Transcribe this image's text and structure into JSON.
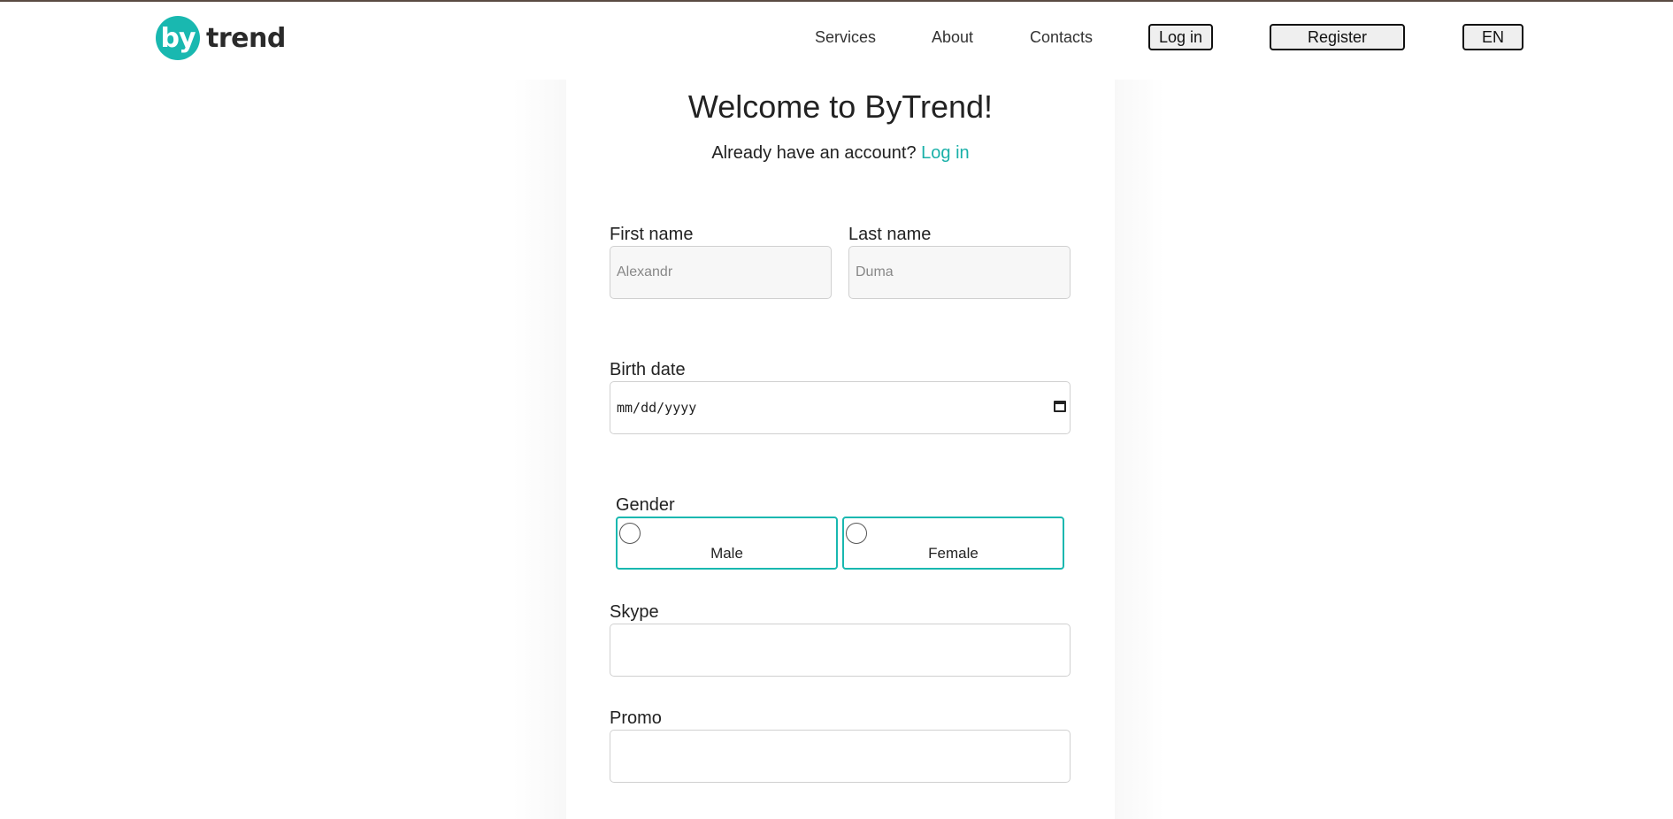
{
  "header": {
    "logo": {
      "mark": "by",
      "word": "trend"
    },
    "nav": [
      "Services",
      "About",
      "Contacts"
    ],
    "login_label": "Log in",
    "register_label": "Register",
    "language_label": "EN"
  },
  "form": {
    "title": "Welcome to ByTrend!",
    "subtitle_text": "Already have an account?",
    "subtitle_link": "Log in",
    "first_name": {
      "label": "First name",
      "placeholder": "Alexandr"
    },
    "last_name": {
      "label": "Last name",
      "placeholder": "Duma"
    },
    "birth_date": {
      "label": "Birth date",
      "placeholder": "mm/dd/yyyy",
      "icon": "calendar-icon"
    },
    "gender": {
      "label": "Gender",
      "options": [
        "Male",
        "Female"
      ]
    },
    "skype": {
      "label": "Skype",
      "value": ""
    },
    "promo": {
      "label": "Promo",
      "value": ""
    }
  },
  "colors": {
    "accent": "#19b8b0",
    "link": "#19b0a8",
    "text": "#222222",
    "input_bg": "#f7f7f7"
  }
}
